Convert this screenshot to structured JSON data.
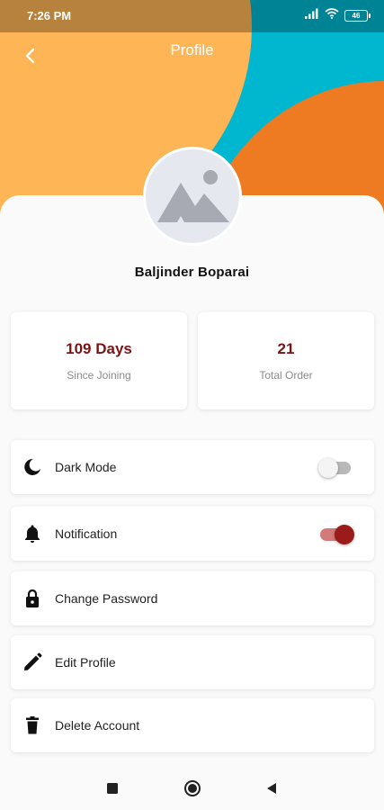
{
  "status_bar": {
    "time": "7:26 PM",
    "battery": "46"
  },
  "header": {
    "title": "Profile"
  },
  "user": {
    "name": "Baljinder Boparai"
  },
  "stats": [
    {
      "value": "109 Days",
      "label": "Since Joining"
    },
    {
      "value": "21",
      "label": "Total Order"
    }
  ],
  "settings": [
    {
      "label": "Dark Mode",
      "icon": "moon-icon",
      "toggle": "off"
    },
    {
      "label": "Notification",
      "icon": "bell-icon",
      "toggle": "on"
    },
    {
      "label": "Change Password",
      "icon": "lock-icon"
    },
    {
      "label": "Edit Profile",
      "icon": "pencil-icon"
    },
    {
      "label": "Delete Account",
      "icon": "trash-icon"
    }
  ],
  "colors": {
    "orange_light": "#FDB555",
    "teal": "#00B7CF",
    "orange_dark": "#EE7B22",
    "accent": "#7a1414",
    "toggle_on": "#9B1B1B"
  }
}
